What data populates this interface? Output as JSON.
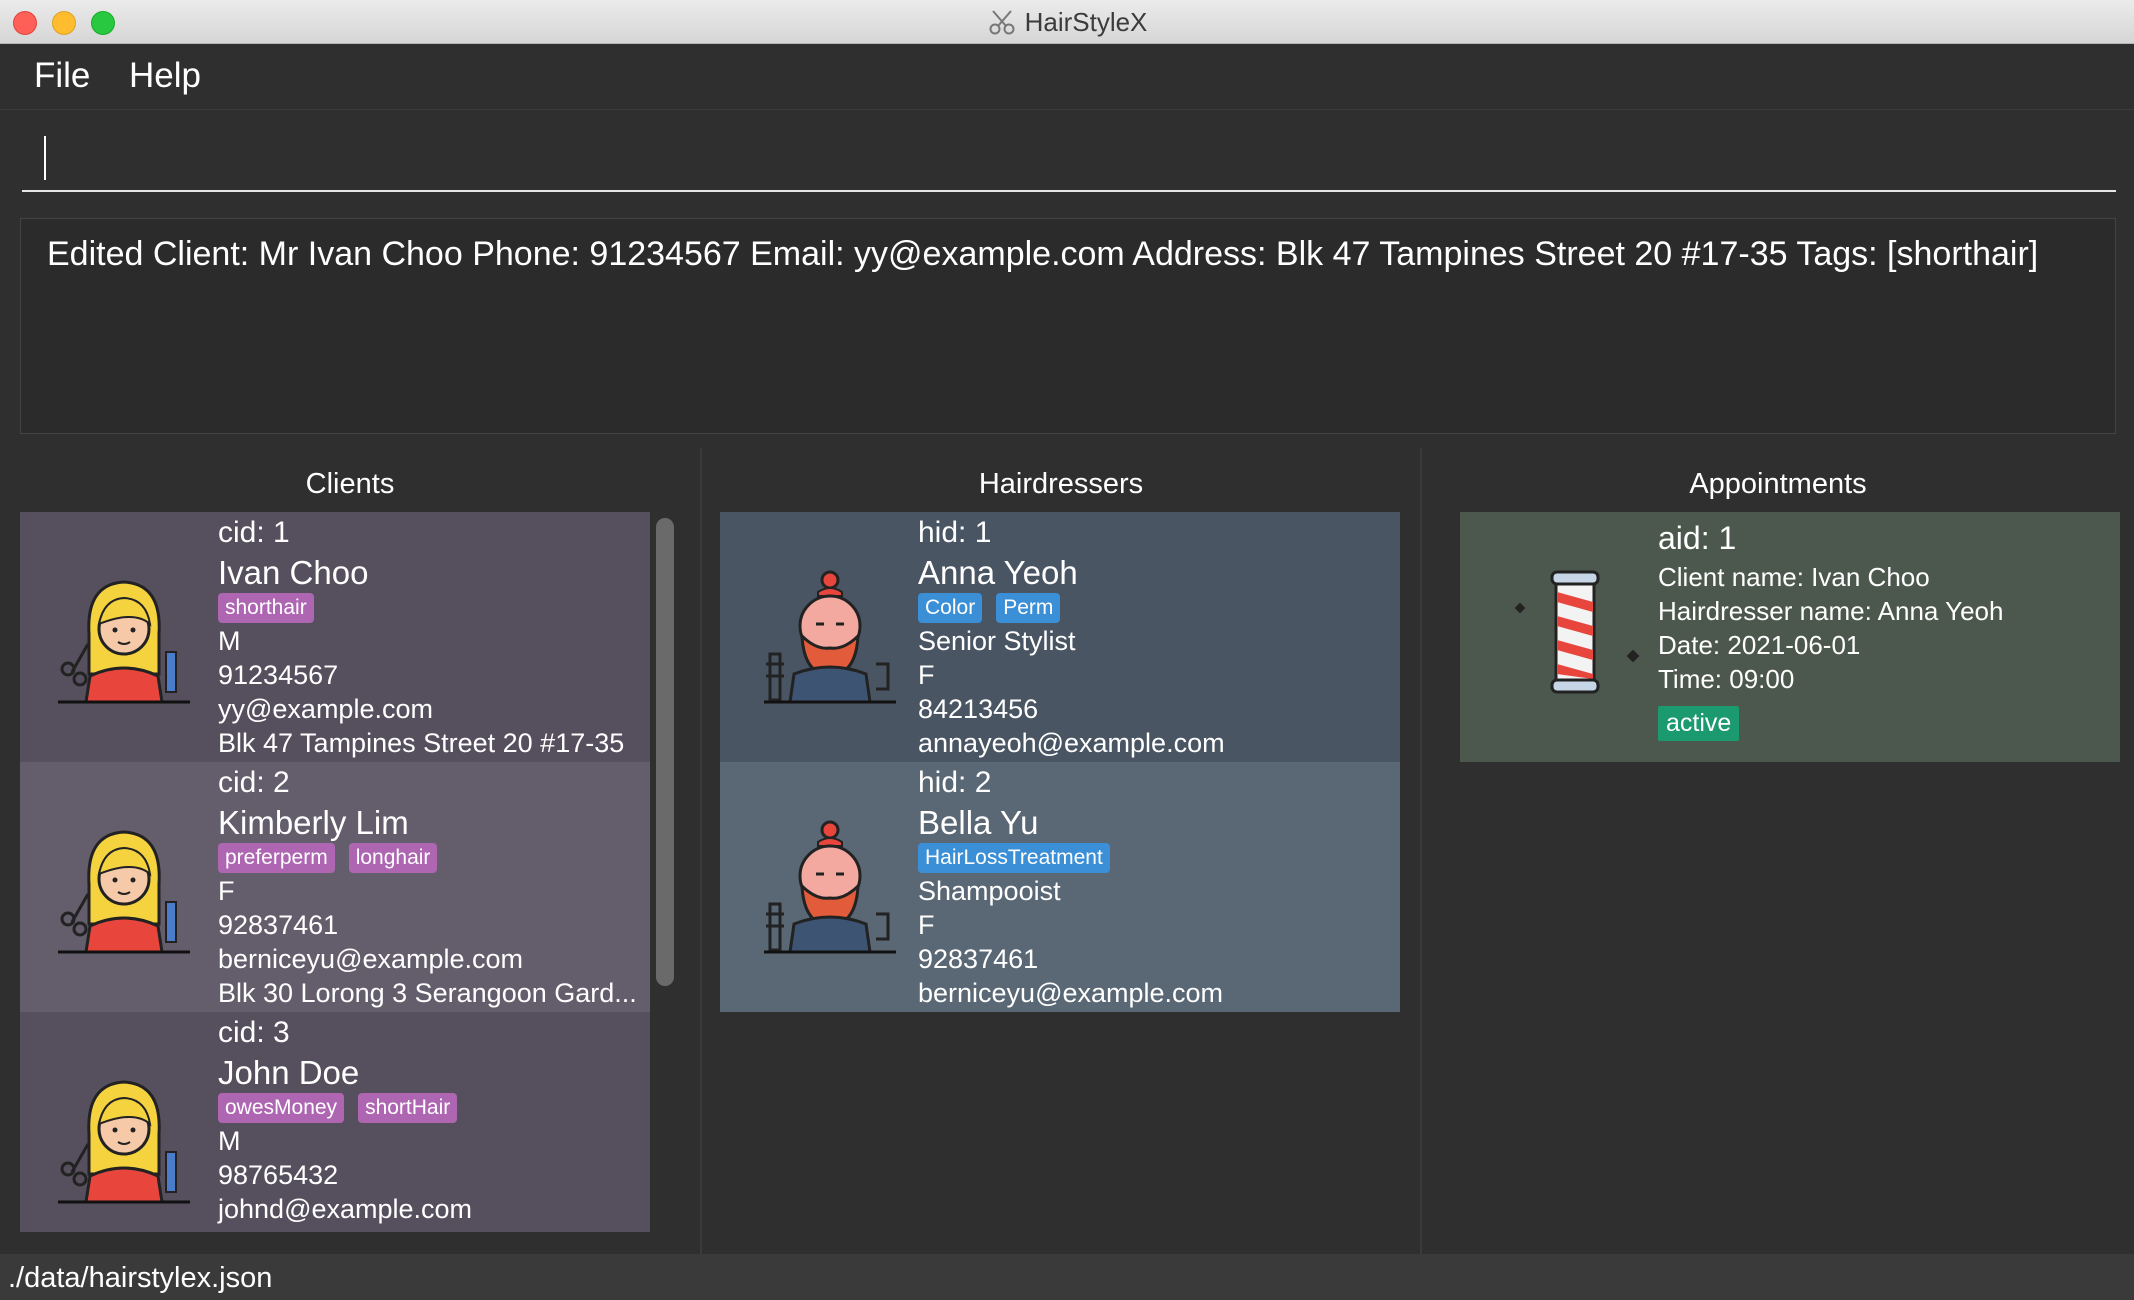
{
  "window": {
    "title": "HairStyleX",
    "icon": "scissors-icon"
  },
  "menu": {
    "file": "File",
    "help": "Help"
  },
  "command": {
    "value": ""
  },
  "result": "Edited Client: Mr Ivan Choo Phone: 91234567 Email: yy@example.com Address: Blk 47 Tampines Street 20 #17-35 Tags: [shorthair]",
  "panels": {
    "clients": "Clients",
    "hairdressers": "Hairdressers",
    "appointments": "Appointments"
  },
  "clients": [
    {
      "id": "cid: 1",
      "name": "Ivan Choo",
      "tags": [
        "shorthair"
      ],
      "gender": "M",
      "phone": "91234567",
      "email": "yy@example.com",
      "address": "Blk 47 Tampines Street 20 #17-35"
    },
    {
      "id": "cid: 2",
      "name": "Kimberly Lim",
      "tags": [
        "preferperm",
        "longhair"
      ],
      "gender": "F",
      "phone": "92837461",
      "email": "berniceyu@example.com",
      "address": "Blk 30 Lorong 3 Serangoon Gard..."
    },
    {
      "id": "cid: 3",
      "name": "John Doe",
      "tags": [
        "owesMoney",
        "shortHair"
      ],
      "gender": "M",
      "phone": "98765432",
      "email": "johnd@example.com"
    }
  ],
  "hairdressers": [
    {
      "id": "hid: 1",
      "name": "Anna Yeoh",
      "tags": [
        "Color",
        "Perm"
      ],
      "title": "Senior Stylist",
      "gender": "F",
      "phone": "84213456",
      "email": "annayeoh@example.com"
    },
    {
      "id": "hid: 2",
      "name": "Bella Yu",
      "tags": [
        "HairLossTreatment"
      ],
      "title": "Shampooist",
      "gender": "F",
      "phone": "92837461",
      "email": "berniceyu@example.com"
    }
  ],
  "appointments": [
    {
      "id": "aid: 1",
      "client": "Client name:  Ivan Choo",
      "hairdresser": "Hairdresser name: Anna Yeoh",
      "date": "Date: 2021-06-01",
      "time": "Time: 09:00",
      "status": "active"
    }
  ],
  "statusbar": "./data/hairstylex.json",
  "colors": {
    "tag_client": "#ae66b3",
    "tag_hairdresser": "#3b8fd6",
    "status_active": "#1a9a6e"
  }
}
